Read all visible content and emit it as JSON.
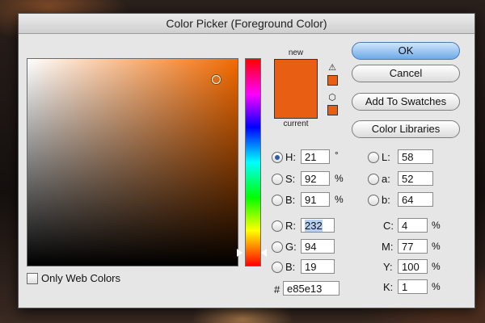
{
  "window": {
    "title": "Color Picker (Foreground Color)"
  },
  "buttons": {
    "ok": "OK",
    "cancel": "Cancel",
    "add_to_swatches": "Add To Swatches",
    "color_libraries": "Color Libraries"
  },
  "swatch": {
    "new_label": "new",
    "current_label": "current",
    "color": "#e85e13"
  },
  "hsb": {
    "h": {
      "label": "H:",
      "value": "21",
      "unit": "°",
      "selected": true
    },
    "s": {
      "label": "S:",
      "value": "92",
      "unit": "%"
    },
    "b": {
      "label": "B:",
      "value": "91",
      "unit": "%"
    }
  },
  "rgb": {
    "r": {
      "label": "R:",
      "value": "232"
    },
    "g": {
      "label": "G:",
      "value": "94"
    },
    "b": {
      "label": "B:",
      "value": "19"
    }
  },
  "lab": {
    "l": {
      "label": "L:",
      "value": "58"
    },
    "a": {
      "label": "a:",
      "value": "52"
    },
    "b": {
      "label": "b:",
      "value": "64"
    }
  },
  "cmyk": {
    "c": {
      "label": "C:",
      "value": "4",
      "unit": "%"
    },
    "m": {
      "label": "M:",
      "value": "77",
      "unit": "%"
    },
    "y": {
      "label": "Y:",
      "value": "100",
      "unit": "%"
    },
    "k": {
      "label": "K:",
      "value": "1",
      "unit": "%"
    }
  },
  "hex": {
    "label": "#",
    "value": "e85e13"
  },
  "only_web_colors": {
    "label": "Only Web Colors",
    "checked": false
  },
  "icons": {
    "gamut_warning": "warning-triangle-icon",
    "web_safe": "cube-icon"
  }
}
